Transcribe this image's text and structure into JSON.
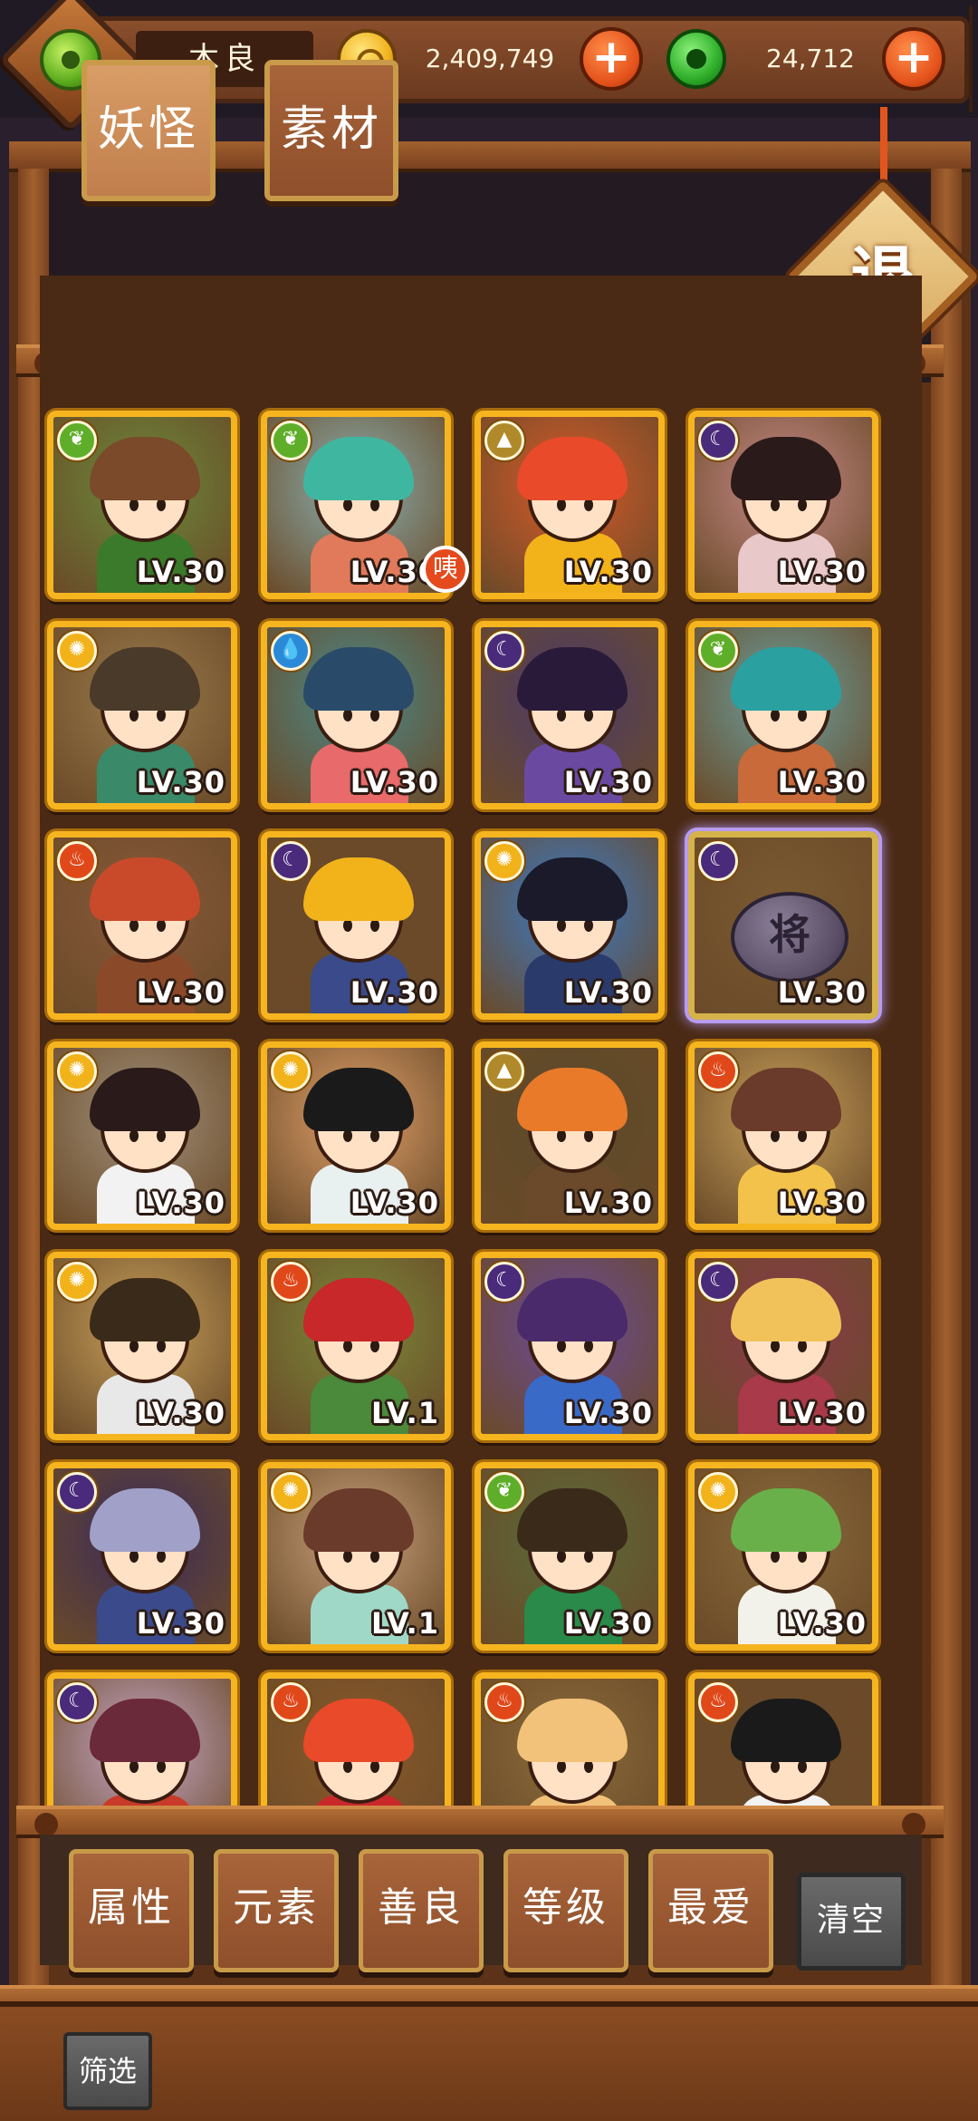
{
  "topbar": {
    "player_name": "木良",
    "gold_amount": "2,409,749",
    "jade_amount": "24,712",
    "plus_label": "+"
  },
  "tabs": [
    {
      "label": "妖怪",
      "active": true
    },
    {
      "label": "素材",
      "active": false
    }
  ],
  "retreat_label": "退",
  "badge_label": "咦",
  "colors": {
    "accent_gold": "#f6b51f",
    "wood": "#8a4c22",
    "button_brown": "#a8643a"
  },
  "cards": [
    {
      "level": "LV.30",
      "element": "wood",
      "bg": "#6b8a3a",
      "hair": "#7a4a2a",
      "body": "#3a7a2a"
    },
    {
      "level": "LV.30",
      "element": "wood",
      "bg": "#8ab0b0",
      "hair": "#3fb7a0",
      "body": "#e07a5a"
    },
    {
      "level": "LV.30",
      "element": "earth",
      "bg": "#d85a2a",
      "hair": "#e84a2a",
      "body": "#f2b21a"
    },
    {
      "level": "LV.30",
      "element": "dark",
      "bg": "#c88a8a",
      "hair": "#2a1a1a",
      "body": "#e8c8c8"
    },
    {
      "level": "LV.30",
      "element": "light",
      "bg": "#9a7a4a",
      "hair": "#4a3a2a",
      "body": "#3a8a6a"
    },
    {
      "level": "LV.30",
      "element": "water",
      "bg": "#4a8a8a",
      "hair": "#2a4a6a",
      "body": "#e86a6a"
    },
    {
      "level": "LV.30",
      "element": "dark",
      "bg": "#4a3a6a",
      "hair": "#2a1a3a",
      "body": "#6a4aa0"
    },
    {
      "level": "LV.30",
      "element": "wood",
      "bg": "#6aa0a0",
      "hair": "#2aa0a0",
      "body": "#c86a3a"
    },
    {
      "level": "LV.30",
      "element": "fire",
      "bg": "#8a5a3a",
      "hair": "#c84a2a",
      "body": "#8a4a2a"
    },
    {
      "level": "LV.30",
      "element": "dark",
      "bg": "#6a4a2a",
      "hair": "#f2b21a",
      "body": "#3a4a8a"
    },
    {
      "level": "LV.30",
      "element": "light",
      "bg": "#3a7ac8",
      "hair": "#1a1a2a",
      "body": "#2a3a6a"
    },
    {
      "level": "LV.30",
      "element": "dark",
      "bg": "#7a5a32",
      "hair": "#7a5a32",
      "body": "#7a5a32",
      "chess": "将"
    },
    {
      "level": "LV.30",
      "element": "light",
      "bg": "#a0907a",
      "hair": "#2a1a1a",
      "body": "#f2f2f2"
    },
    {
      "level": "LV.30",
      "element": "light",
      "bg": "#e0a06a",
      "hair": "#1a1a1a",
      "body": "#e8f0f0"
    },
    {
      "level": "LV.30",
      "element": "earth",
      "bg": "#5a4a2a",
      "hair": "#e87a2a",
      "body": "#6a4a2a"
    },
    {
      "level": "LV.30",
      "element": "fire",
      "bg": "#c8a05a",
      "hair": "#6a3a2a",
      "body": "#f2c24a"
    },
    {
      "level": "LV.30",
      "element": "light",
      "bg": "#c8a05a",
      "hair": "#3a2a1a",
      "body": "#e8e8e8"
    },
    {
      "level": "LV.1",
      "element": "fire",
      "bg": "#7a8a3a",
      "hair": "#c8282a",
      "body": "#4a8a3a"
    },
    {
      "level": "LV.30",
      "element": "dark",
      "bg": "#6a4a9a",
      "hair": "#4a2a6a",
      "body": "#3a6ac8"
    },
    {
      "level": "LV.30",
      "element": "dark",
      "bg": "#8a3a4a",
      "hair": "#f2c25a",
      "body": "#a83a4a"
    },
    {
      "level": "LV.30",
      "element": "dark",
      "bg": "#3a2a5a",
      "hair": "#a0a0c8",
      "body": "#3a4a8a"
    },
    {
      "level": "LV.1",
      "element": "light",
      "bg": "#c8a07a",
      "hair": "#6a3a2a",
      "body": "#a0d8c8"
    },
    {
      "level": "LV.30",
      "element": "wood",
      "bg": "#5a6a3a",
      "hair": "#3a2a1a",
      "body": "#2a8a4a"
    },
    {
      "level": "LV.30",
      "element": "light",
      "bg": "#8a6a3a",
      "hair": "#6ab04a",
      "body": "#f2f2ea"
    },
    {
      "level": "",
      "element": "dark",
      "bg": "#c8a8c8",
      "hair": "#6a2a3a",
      "body": "#c83a2a"
    },
    {
      "level": "",
      "element": "fire",
      "bg": "#8a5a2a",
      "hair": "#e84a2a",
      "body": "#c8282a"
    },
    {
      "level": "",
      "element": "fire",
      "bg": "#8a6a3a",
      "hair": "#f2c27a",
      "body": "#f2c27a"
    },
    {
      "level": "",
      "element": "fire",
      "bg": "#6a4a2a",
      "hair": "#1a1a1a",
      "body": "#f2f2f2"
    }
  ],
  "filters": [
    "属性",
    "元素",
    "善良",
    "等级",
    "最爱"
  ],
  "clear_label": "清空",
  "screen_label": "筛选"
}
